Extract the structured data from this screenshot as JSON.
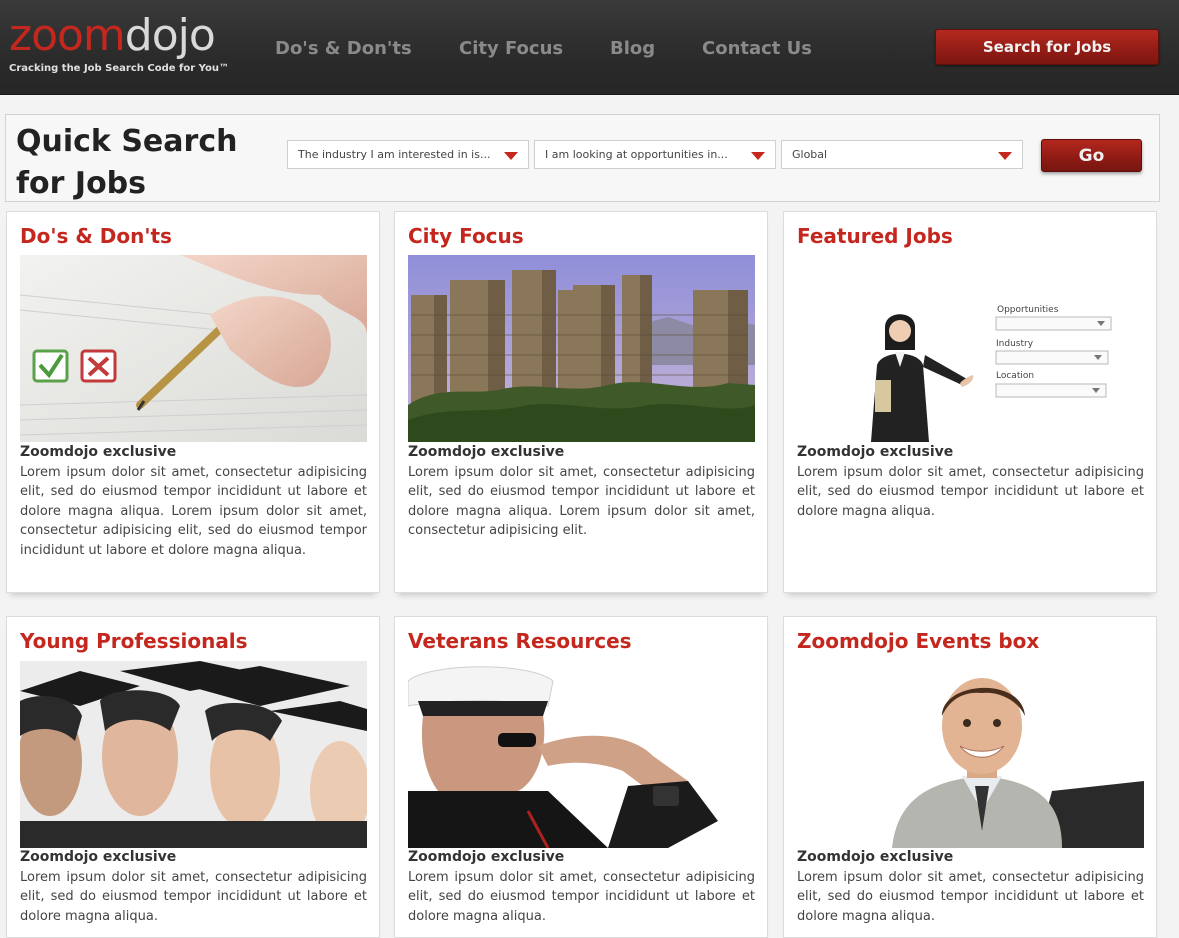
{
  "header": {
    "logo": {
      "part1": "zoom",
      "part2": "dojo"
    },
    "tagline": "Cracking the Job Search Code for You™",
    "nav": [
      {
        "label": "Do's & Don'ts"
      },
      {
        "label": "City Focus"
      },
      {
        "label": "Blog"
      },
      {
        "label": "Contact Us"
      }
    ],
    "search_button": "Search for Jobs"
  },
  "quick_search": {
    "title_line1": "Quick Search",
    "title_line2": "for Jobs",
    "industry_select": "The industry I am interested in is...",
    "opportunities_select": "I am looking at opportunities in...",
    "location_select": "Global",
    "go_button": "Go"
  },
  "cards": [
    {
      "title": "Do's & Don'ts",
      "subtitle": "Zoomdojo exclusive",
      "body": "Lorem ipsum dolor sit amet, consectetur adipisicing elit, sed do eiusmod tempor incididunt ut labore et dolore magna aliqua. Lorem ipsum dolor sit amet, consectetur adipisicing elit, sed do eiusmod tempor incididunt ut labore et dolore magna aliqua."
    },
    {
      "title": "City Focus",
      "subtitle": "Zoomdojo exclusive",
      "body": "Lorem ipsum dolor sit amet, consectetur adipisicing elit, sed do eiusmod tempor incididunt ut labore et dolore magna aliqua. Lorem ipsum dolor sit amet, consectetur adipisicing elit."
    },
    {
      "title": "Featured Jobs",
      "subtitle": "Zoomdojo exclusive",
      "body": "Lorem ipsum dolor sit amet, consectetur adipisicing elit, sed do eiusmod tempor incididunt ut labore et dolore magna aliqua.",
      "image_labels": {
        "opportunities": "Opportunities",
        "industry": "Industry",
        "location": "Location"
      }
    },
    {
      "title": "Young Professionals",
      "subtitle": "Zoomdojo exclusive",
      "body": "Lorem ipsum dolor sit amet, consectetur adipisicing elit, sed do eiusmod tempor incididunt ut labore et dolore magna aliqua."
    },
    {
      "title": "Veterans Resources",
      "subtitle": "Zoomdojo exclusive",
      "body": "Lorem ipsum dolor sit amet, consectetur adipisicing elit, sed do eiusmod tempor incididunt ut labore et dolore magna aliqua."
    },
    {
      "title": "Zoomdojo Events box",
      "subtitle": "Zoomdojo exclusive",
      "body": "Lorem ipsum dolor sit amet, consectetur adipisicing elit, sed do eiusmod tempor incididunt ut labore et dolore magna aliqua."
    }
  ],
  "colors": {
    "brand_red": "#c4271e",
    "header_bg": "#2b2b2b",
    "nav_text": "#8a8a8a"
  }
}
